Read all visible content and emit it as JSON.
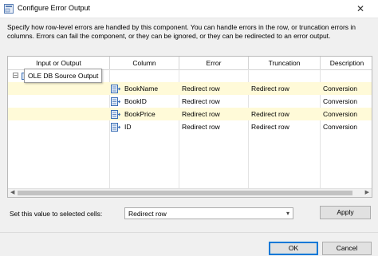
{
  "window": {
    "title": "Configure Error Output",
    "close_glyph": "✕"
  },
  "description": "Specify how row-level errors are handled by this component. You can handle errors in the row, or truncation errors in columns. Errors can fail the component, or they can be ignored, or they can be redirected to an error output.",
  "grid": {
    "headers": [
      "Input or Output",
      "Column",
      "Error",
      "Truncation",
      "Description"
    ],
    "group": {
      "collapse_glyph": "−",
      "name": "OLE DB Source Output"
    },
    "rows": [
      {
        "column": "BookName",
        "error": "Redirect row",
        "truncation": "Redirect row",
        "description": "Conversion"
      },
      {
        "column": "BookID",
        "error": "Redirect row",
        "truncation": "",
        "description": "Conversion"
      },
      {
        "column": "BookPrice",
        "error": "Redirect row",
        "truncation": "Redirect row",
        "description": "Conversion"
      },
      {
        "column": "ID",
        "error": "Redirect row",
        "truncation": "Redirect row",
        "description": "Conversion"
      }
    ],
    "scroll_left": "◀",
    "scroll_right": "▶"
  },
  "footer": {
    "set_label": "Set this value to selected cells:",
    "dropdown_value": "Redirect row",
    "dropdown_chevron": "▾",
    "apply_label": "Apply",
    "ok_label": "OK",
    "cancel_label": "Cancel"
  },
  "colors": {
    "row_highlight": "#fffad8",
    "accent": "#0078d7"
  }
}
